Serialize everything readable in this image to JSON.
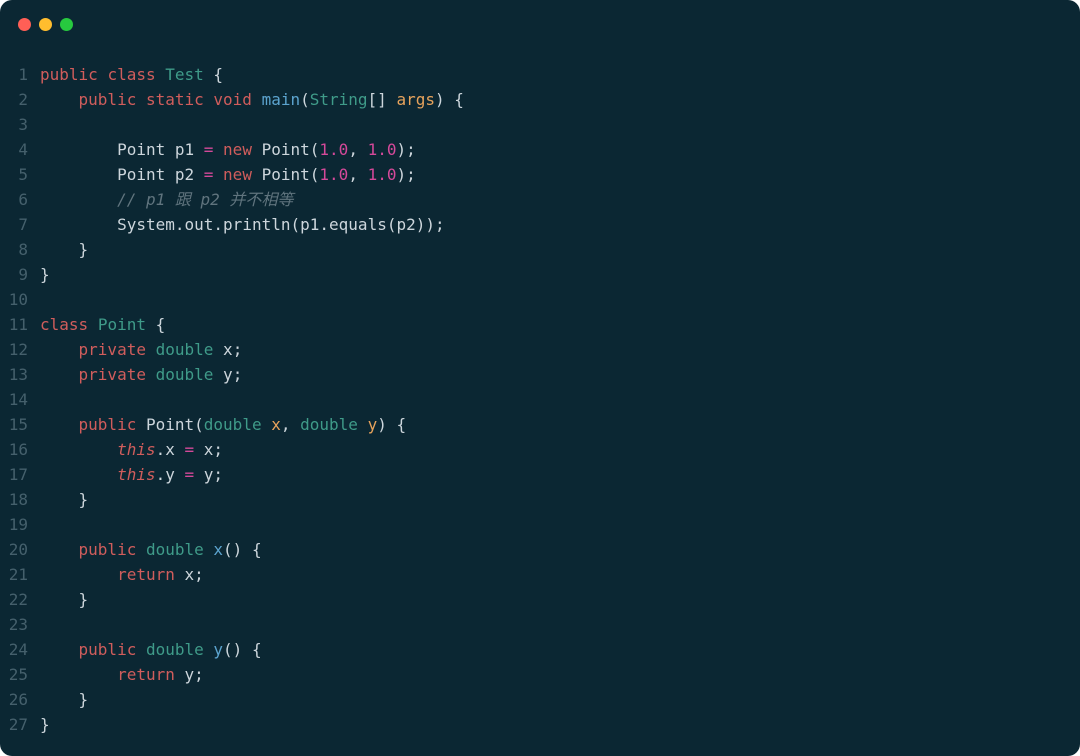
{
  "window": {
    "traffic_lights": {
      "red": "#ff5f56",
      "yellow": "#ffbd2e",
      "green": "#27c93f"
    },
    "background": "#0b2733"
  },
  "code": {
    "language": "java",
    "lines": [
      {
        "n": 1,
        "tokens": [
          {
            "t": "public",
            "c": "kw-mod"
          },
          {
            "t": " ",
            "c": "ident"
          },
          {
            "t": "class",
            "c": "kw-mod"
          },
          {
            "t": " ",
            "c": "ident"
          },
          {
            "t": "Test",
            "c": "type"
          },
          {
            "t": " {",
            "c": "punct"
          }
        ]
      },
      {
        "n": 2,
        "tokens": [
          {
            "t": "    ",
            "c": "ident"
          },
          {
            "t": "public",
            "c": "kw-mod"
          },
          {
            "t": " ",
            "c": "ident"
          },
          {
            "t": "static",
            "c": "kw-mod"
          },
          {
            "t": " ",
            "c": "ident"
          },
          {
            "t": "void",
            "c": "kw-mod"
          },
          {
            "t": " ",
            "c": "ident"
          },
          {
            "t": "main",
            "c": "method"
          },
          {
            "t": "(",
            "c": "punct"
          },
          {
            "t": "String",
            "c": "type"
          },
          {
            "t": "[] ",
            "c": "punct"
          },
          {
            "t": "args",
            "c": "paramname"
          },
          {
            "t": ") {",
            "c": "punct"
          }
        ]
      },
      {
        "n": 3,
        "tokens": []
      },
      {
        "n": 4,
        "tokens": [
          {
            "t": "        ",
            "c": "ident"
          },
          {
            "t": "Point ",
            "c": "type2"
          },
          {
            "t": "p1 ",
            "c": "ident"
          },
          {
            "t": "=",
            "c": "op"
          },
          {
            "t": " ",
            "c": "ident"
          },
          {
            "t": "new",
            "c": "kw-new"
          },
          {
            "t": " ",
            "c": "ident"
          },
          {
            "t": "Point",
            "c": "type2"
          },
          {
            "t": "(",
            "c": "punct"
          },
          {
            "t": "1.0",
            "c": "num"
          },
          {
            "t": ", ",
            "c": "punct"
          },
          {
            "t": "1.0",
            "c": "num"
          },
          {
            "t": ");",
            "c": "punct"
          }
        ]
      },
      {
        "n": 5,
        "tokens": [
          {
            "t": "        ",
            "c": "ident"
          },
          {
            "t": "Point ",
            "c": "type2"
          },
          {
            "t": "p2 ",
            "c": "ident"
          },
          {
            "t": "=",
            "c": "op"
          },
          {
            "t": " ",
            "c": "ident"
          },
          {
            "t": "new",
            "c": "kw-new"
          },
          {
            "t": " ",
            "c": "ident"
          },
          {
            "t": "Point",
            "c": "type2"
          },
          {
            "t": "(",
            "c": "punct"
          },
          {
            "t": "1.0",
            "c": "num"
          },
          {
            "t": ", ",
            "c": "punct"
          },
          {
            "t": "1.0",
            "c": "num"
          },
          {
            "t": ");",
            "c": "punct"
          }
        ]
      },
      {
        "n": 6,
        "tokens": [
          {
            "t": "        ",
            "c": "ident"
          },
          {
            "t": "// p1 跟 p2 并不相等",
            "c": "comment"
          }
        ]
      },
      {
        "n": 7,
        "tokens": [
          {
            "t": "        ",
            "c": "ident"
          },
          {
            "t": "System",
            "c": "type2"
          },
          {
            "t": ".",
            "c": "punct"
          },
          {
            "t": "out",
            "c": "field"
          },
          {
            "t": ".",
            "c": "punct"
          },
          {
            "t": "println",
            "c": "ident"
          },
          {
            "t": "(",
            "c": "punct"
          },
          {
            "t": "p1",
            "c": "ident"
          },
          {
            "t": ".",
            "c": "punct"
          },
          {
            "t": "equals",
            "c": "ident"
          },
          {
            "t": "(",
            "c": "punct"
          },
          {
            "t": "p2",
            "c": "ident"
          },
          {
            "t": "));",
            "c": "punct"
          }
        ]
      },
      {
        "n": 8,
        "tokens": [
          {
            "t": "    }",
            "c": "punct"
          }
        ]
      },
      {
        "n": 9,
        "tokens": [
          {
            "t": "}",
            "c": "punct"
          }
        ]
      },
      {
        "n": 10,
        "tokens": []
      },
      {
        "n": 11,
        "tokens": [
          {
            "t": "class",
            "c": "kw-mod"
          },
          {
            "t": " ",
            "c": "ident"
          },
          {
            "t": "Point",
            "c": "type"
          },
          {
            "t": " {",
            "c": "punct"
          }
        ]
      },
      {
        "n": 12,
        "tokens": [
          {
            "t": "    ",
            "c": "ident"
          },
          {
            "t": "private",
            "c": "kw-mod"
          },
          {
            "t": " ",
            "c": "ident"
          },
          {
            "t": "double",
            "c": "type"
          },
          {
            "t": " ",
            "c": "ident"
          },
          {
            "t": "x",
            "c": "ident"
          },
          {
            "t": ";",
            "c": "punct"
          }
        ]
      },
      {
        "n": 13,
        "tokens": [
          {
            "t": "    ",
            "c": "ident"
          },
          {
            "t": "private",
            "c": "kw-mod"
          },
          {
            "t": " ",
            "c": "ident"
          },
          {
            "t": "double",
            "c": "type"
          },
          {
            "t": " ",
            "c": "ident"
          },
          {
            "t": "y",
            "c": "ident"
          },
          {
            "t": ";",
            "c": "punct"
          }
        ]
      },
      {
        "n": 14,
        "tokens": []
      },
      {
        "n": 15,
        "tokens": [
          {
            "t": "    ",
            "c": "ident"
          },
          {
            "t": "public",
            "c": "kw-mod"
          },
          {
            "t": " ",
            "c": "ident"
          },
          {
            "t": "Point",
            "c": "type2"
          },
          {
            "t": "(",
            "c": "punct"
          },
          {
            "t": "double",
            "c": "type"
          },
          {
            "t": " ",
            "c": "ident"
          },
          {
            "t": "x",
            "c": "paramname"
          },
          {
            "t": ", ",
            "c": "punct"
          },
          {
            "t": "double",
            "c": "type"
          },
          {
            "t": " ",
            "c": "ident"
          },
          {
            "t": "y",
            "c": "paramname"
          },
          {
            "t": ") {",
            "c": "punct"
          }
        ]
      },
      {
        "n": 16,
        "tokens": [
          {
            "t": "        ",
            "c": "ident"
          },
          {
            "t": "this",
            "c": "kw-this"
          },
          {
            "t": ".",
            "c": "punct"
          },
          {
            "t": "x ",
            "c": "field"
          },
          {
            "t": "=",
            "c": "op"
          },
          {
            "t": " ",
            "c": "ident"
          },
          {
            "t": "x",
            "c": "ident"
          },
          {
            "t": ";",
            "c": "punct"
          }
        ]
      },
      {
        "n": 17,
        "tokens": [
          {
            "t": "        ",
            "c": "ident"
          },
          {
            "t": "this",
            "c": "kw-this"
          },
          {
            "t": ".",
            "c": "punct"
          },
          {
            "t": "y ",
            "c": "field"
          },
          {
            "t": "=",
            "c": "op"
          },
          {
            "t": " ",
            "c": "ident"
          },
          {
            "t": "y",
            "c": "ident"
          },
          {
            "t": ";",
            "c": "punct"
          }
        ]
      },
      {
        "n": 18,
        "tokens": [
          {
            "t": "    }",
            "c": "punct"
          }
        ]
      },
      {
        "n": 19,
        "tokens": []
      },
      {
        "n": 20,
        "tokens": [
          {
            "t": "    ",
            "c": "ident"
          },
          {
            "t": "public",
            "c": "kw-mod"
          },
          {
            "t": " ",
            "c": "ident"
          },
          {
            "t": "double",
            "c": "type"
          },
          {
            "t": " ",
            "c": "ident"
          },
          {
            "t": "x",
            "c": "method"
          },
          {
            "t": "() {",
            "c": "punct"
          }
        ]
      },
      {
        "n": 21,
        "tokens": [
          {
            "t": "        ",
            "c": "ident"
          },
          {
            "t": "return",
            "c": "kw-mod"
          },
          {
            "t": " ",
            "c": "ident"
          },
          {
            "t": "x",
            "c": "ident"
          },
          {
            "t": ";",
            "c": "punct"
          }
        ]
      },
      {
        "n": 22,
        "tokens": [
          {
            "t": "    }",
            "c": "punct"
          }
        ]
      },
      {
        "n": 23,
        "tokens": []
      },
      {
        "n": 24,
        "tokens": [
          {
            "t": "    ",
            "c": "ident"
          },
          {
            "t": "public",
            "c": "kw-mod"
          },
          {
            "t": " ",
            "c": "ident"
          },
          {
            "t": "double",
            "c": "type"
          },
          {
            "t": " ",
            "c": "ident"
          },
          {
            "t": "y",
            "c": "method"
          },
          {
            "t": "() {",
            "c": "punct"
          }
        ]
      },
      {
        "n": 25,
        "tokens": [
          {
            "t": "        ",
            "c": "ident"
          },
          {
            "t": "return",
            "c": "kw-mod"
          },
          {
            "t": " ",
            "c": "ident"
          },
          {
            "t": "y",
            "c": "ident"
          },
          {
            "t": ";",
            "c": "punct"
          }
        ]
      },
      {
        "n": 26,
        "tokens": [
          {
            "t": "    }",
            "c": "punct"
          }
        ]
      },
      {
        "n": 27,
        "tokens": [
          {
            "t": "}",
            "c": "punct"
          }
        ]
      }
    ]
  }
}
